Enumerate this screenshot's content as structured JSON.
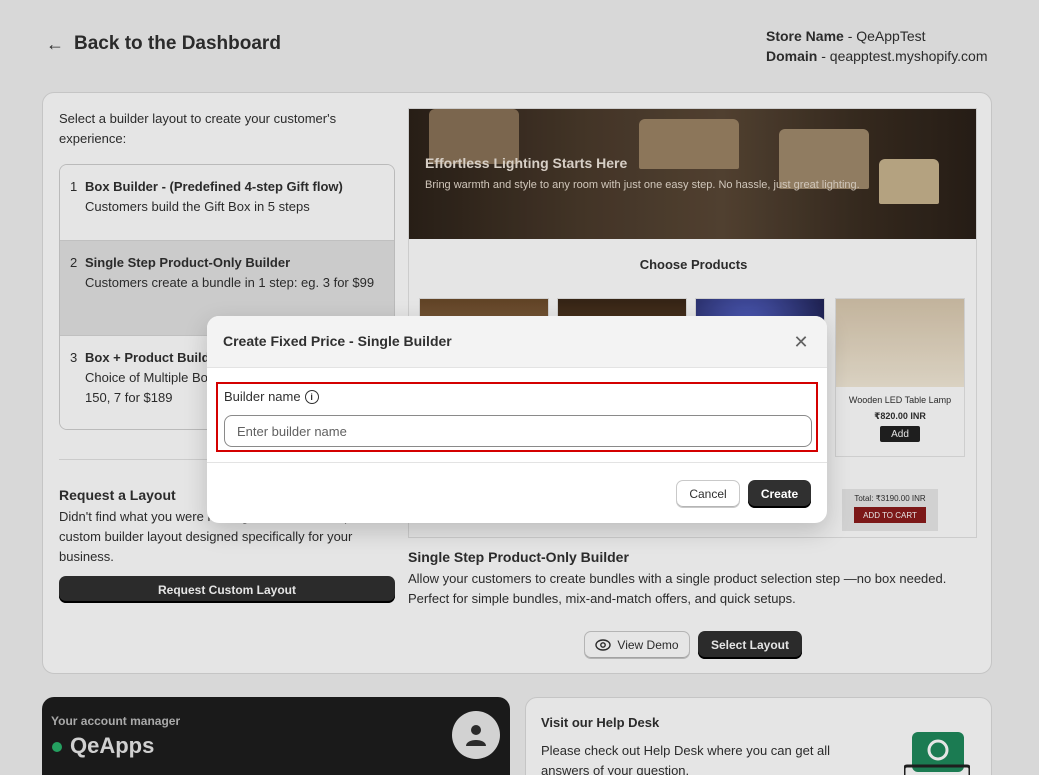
{
  "header": {
    "back_label": "Back to the Dashboard",
    "store_label": "Store Name",
    "store_value": "- QeAppTest",
    "domain_label": "Domain",
    "domain_value": "- qeapptest.myshopify.com"
  },
  "main": {
    "intro": "Select a builder layout to create your customer's experience:",
    "layouts": [
      {
        "num": "1",
        "name": "Box Builder - (Predefined 4-step Gift flow)",
        "desc": "Customers build the Gift Box in 5 steps"
      },
      {
        "num": "2",
        "name": "Single Step Product-Only Builder",
        "desc": "Customers create a bundle in 1 step: eg. 3 for $99"
      },
      {
        "num": "3",
        "name": "Box + Product Builder",
        "desc": "Choice of Multiple Boxes and Products: eg. 3 for $ 150, 7 for $189"
      }
    ],
    "request": {
      "title": "Request a Layout",
      "desc": "Didn't find what you were looking for? You can request a custom builder layout designed specifically for your business.",
      "button": "Request Custom Layout"
    },
    "preview": {
      "banner_title": "Effortless Lighting Starts Here",
      "banner_sub": "Bring warmth and style to any room with just one easy step. No hassle, just great lighting.",
      "choose": "Choose Products",
      "product": {
        "name": "Wooden LED Table Lamp",
        "price": "₹820.00 INR",
        "add": "Add"
      },
      "total": "Total: ₹3190.00 INR",
      "cart": "ADD TO CART"
    },
    "selected": {
      "title": "Single Step Product-Only Builder",
      "desc": "Allow your customers to create bundles with a single product selection step —no box needed. Perfect for simple bundles, mix-and-match offers, and quick setups.",
      "demo_btn": "View Demo",
      "select_btn": "Select Layout"
    }
  },
  "account": {
    "label": "Your account manager",
    "name": "QeApps"
  },
  "help": {
    "title": "Visit our Help Desk",
    "desc": "Please check out Help Desk where you can get all answers of your question."
  },
  "modal": {
    "title": "Create Fixed Price - Single Builder",
    "field_label": "Builder name",
    "placeholder": "Enter builder name",
    "value": "",
    "cancel": "Cancel",
    "create": "Create"
  },
  "colors": {
    "primary_button": "#303030",
    "highlight_border": "#d40000",
    "status_online": "#29b36b",
    "cart_button": "#8b1b1b"
  }
}
